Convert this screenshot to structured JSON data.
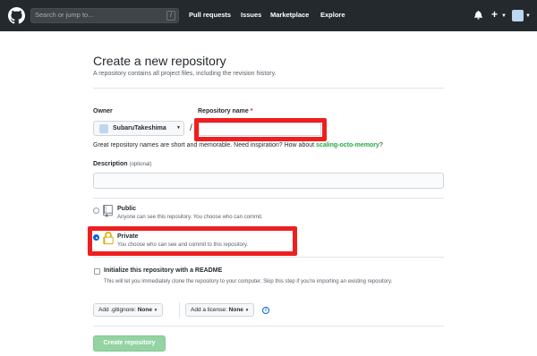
{
  "header": {
    "search_placeholder": "Search or jump to...",
    "search_shortcut": "/",
    "nav": [
      "Pull requests",
      "Issues",
      "Marketplace",
      "Explore"
    ],
    "new_menu_label": "+"
  },
  "page": {
    "title": "Create a new repository",
    "subtitle": "A repository contains all project files, including the revision history."
  },
  "owner": {
    "label": "Owner",
    "value": "SubaruTakeshima"
  },
  "repo_name": {
    "label": "Repository name",
    "required_mark": "*",
    "value": ""
  },
  "separator": "/",
  "hint": {
    "text": "Great repository names are short and memorable. Need inspiration? How about ",
    "suggestion": "scaling-octo-memory",
    "end": "?"
  },
  "description": {
    "label": "Description",
    "optional": "(optional)",
    "value": ""
  },
  "visibility": {
    "public": {
      "title": "Public",
      "desc": "Anyone can see this repository. You choose who can commit."
    },
    "private": {
      "title": "Private",
      "desc": "You choose who can see and commit to this repository.",
      "selected": true
    }
  },
  "readme": {
    "title": "Initialize this repository with a README",
    "desc": "This will let you immediately clone the repository to your computer. Skip this step if you're importing an existing repository."
  },
  "gitignore": {
    "label": "Add .gitignore:",
    "value": "None"
  },
  "license": {
    "label": "Add a license:",
    "value": "None"
  },
  "info_glyph": "i",
  "create_button": "Create repository",
  "colors": {
    "header_bg": "#24292e",
    "highlight": "#ee1f1f",
    "create_button": "#94d3a2",
    "suggestion": "#28a745"
  }
}
